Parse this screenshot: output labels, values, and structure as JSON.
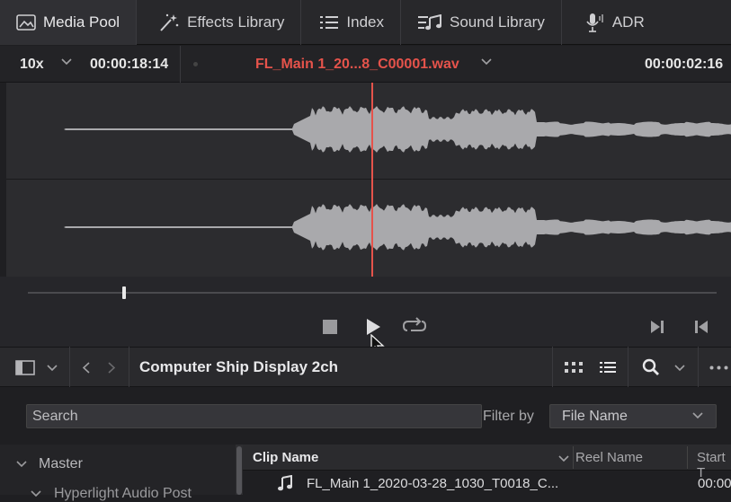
{
  "tabs": [
    {
      "label": "Media Pool",
      "icon": "media-pool-icon",
      "active": true
    },
    {
      "label": "Effects Library",
      "icon": "effects-wand-icon",
      "active": false
    },
    {
      "label": "Index",
      "icon": "index-list-icon",
      "active": false
    },
    {
      "label": "Sound Library",
      "icon": "sound-library-icon",
      "active": false
    },
    {
      "label": "ADR",
      "icon": "microphone-icon",
      "active": false
    }
  ],
  "viewer": {
    "zoom": "10x",
    "timecode_left": "00:00:18:14",
    "clip_name": "FL_Main 1_20...8_C00001.wav",
    "timecode_right": "00:00:02:16",
    "scrub_position": 0.14,
    "playhead_position": 0.5
  },
  "transport": {
    "stop": "stop-icon",
    "play": "play-icon",
    "loop": "loop-icon",
    "next": "next-frame-icon",
    "prev": "previous-frame-icon"
  },
  "browser": {
    "bin_title": "Computer Ship Display 2ch",
    "search_placeholder": "Search",
    "filter_label": "Filter by",
    "filter_value": "File Name"
  },
  "bins": {
    "master": "Master",
    "sub": "Hyperlight Audio Post"
  },
  "table": {
    "headers": [
      "Clip Name",
      "Reel Name",
      "Start T"
    ],
    "rows": [
      {
        "clip_name": "FL_Main 1_2020-03-28_1030_T0018_C...",
        "start": "00:00"
      }
    ]
  },
  "colors": {
    "accent_red": "#e5534b",
    "background": "#1f1f22",
    "waveform": "#a9a9ac"
  }
}
